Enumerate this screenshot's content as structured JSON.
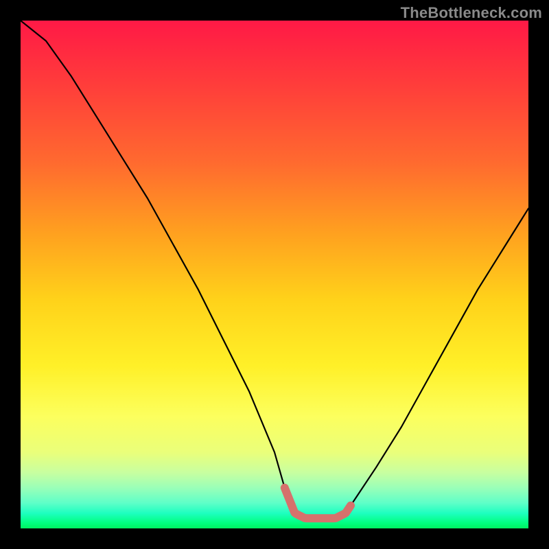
{
  "watermark": "TheBottleneck.com",
  "chart_data": {
    "type": "line",
    "title": "",
    "xlabel": "",
    "ylabel": "",
    "xlim": [
      0,
      100
    ],
    "ylim": [
      0,
      100
    ],
    "series": [
      {
        "name": "bottleneck-curve",
        "x": [
          0,
          5,
          10,
          15,
          20,
          25,
          30,
          35,
          40,
          45,
          50,
          52,
          54,
          56,
          58,
          60,
          62,
          64,
          66,
          70,
          75,
          80,
          85,
          90,
          95,
          100
        ],
        "values": [
          100,
          96,
          89,
          81,
          73,
          65,
          56,
          47,
          37,
          27,
          15,
          8,
          3,
          2,
          2,
          2,
          2,
          3,
          6,
          12,
          20,
          29,
          38,
          47,
          55,
          63
        ]
      }
    ],
    "highlight_band": {
      "name": "optimal-range",
      "x_start": 52,
      "x_end": 65,
      "color": "#d6716c",
      "thickness_px": 12
    },
    "grid": false,
    "legend": false
  }
}
